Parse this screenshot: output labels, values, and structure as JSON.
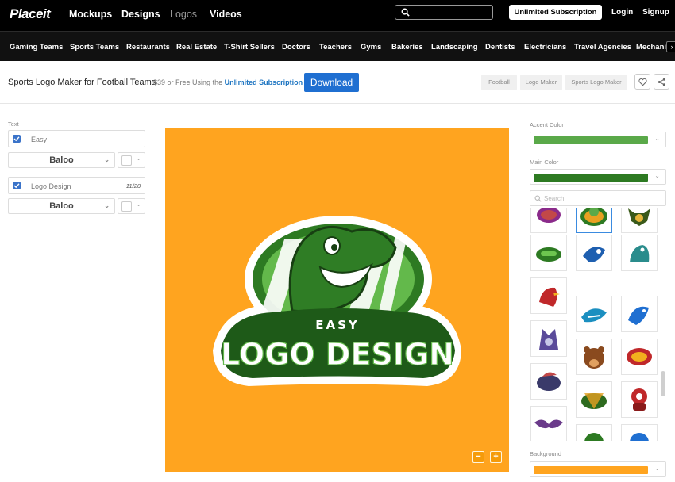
{
  "header": {
    "logo": "Placeit",
    "nav": [
      "Mockups",
      "Designs",
      "Logos",
      "Videos"
    ],
    "search_placeholder": "",
    "unlimited": "Unlimited Subscription",
    "login": "Login",
    "signup": "Signup"
  },
  "categories": [
    "Gaming Teams",
    "Sports Teams",
    "Restaurants",
    "Real Estate",
    "T-Shirt Sellers",
    "Doctors",
    "Teachers",
    "Gyms",
    "Bakeries",
    "Landscaping",
    "Dentists",
    "Electricians",
    "Travel Agencies",
    "Mechanic"
  ],
  "title_bar": {
    "title": "Sports Logo Maker for Football Teams",
    "price": "$39",
    "price_or": "or Free Using the",
    "price_link": "Unlimited Subscription",
    "download": "Download",
    "tags": [
      "Football",
      "Logo Maker",
      "Sports Logo Maker"
    ]
  },
  "left_panel": {
    "label": "Text",
    "fields": [
      {
        "value": "Easy",
        "font": "Baloo",
        "counter": ""
      },
      {
        "value": "Logo Design",
        "font": "Baloo",
        "counter": "11/20"
      }
    ],
    "font_caret": "⌄",
    "color_caret": "⌄"
  },
  "canvas": {
    "background": "#ffa41f",
    "text_small": "EASY",
    "text_large": "LOGO DESIGN",
    "zoom_out": "−",
    "zoom_in": "+"
  },
  "right_panel": {
    "accent_label": "Accent Color",
    "accent_color": "#5aa949",
    "main_label": "Main Color",
    "main_color": "#2d7a22",
    "search_placeholder": "Search",
    "background_label": "Background",
    "background_color": "#ffa41f",
    "caret": "⌄",
    "icons": [
      "football-icon",
      "football-dino-icon",
      "bull-icon",
      "football-helmet-icon",
      "eagle-icon",
      "seal-icon",
      "cardinal-icon",
      "shark-icon",
      "dolphin-icon",
      "wolf-icon",
      "bear-icon",
      "football-face-icon",
      "football-bird-icon",
      "football-team-icon",
      "robot-icon",
      "bat-icon",
      "bird-icon",
      "football-player-icon"
    ]
  },
  "colors": {
    "brand_blue": "#1f6fd1",
    "logo_green": "#2d7a22",
    "logo_light_green": "#63b94b"
  }
}
